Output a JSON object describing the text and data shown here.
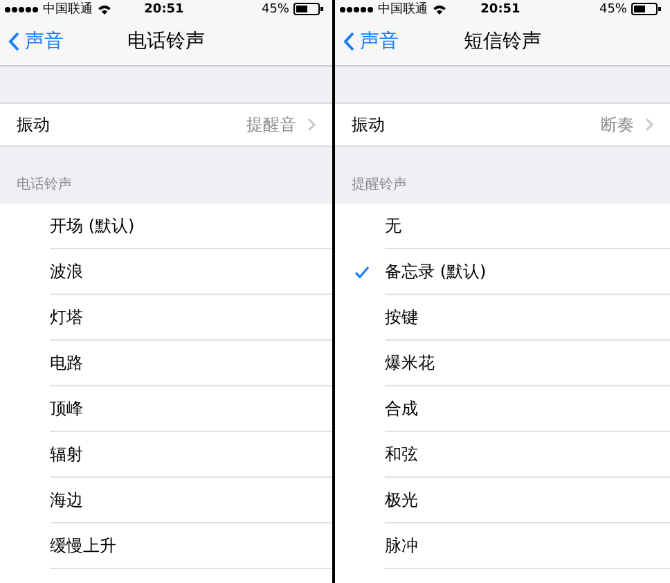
{
  "panels": [
    {
      "status_bar": {
        "carrier": "中国联通",
        "time": "20:51",
        "battery": "45%"
      },
      "nav_bar": {
        "back": "声音",
        "title": "电话铃声"
      },
      "vibration": {
        "label": "振动",
        "value": "提醒音"
      },
      "section_header": "电话铃声",
      "tones": [
        {
          "label": "开场 (默认)",
          "selected": false
        },
        {
          "label": "波浪",
          "selected": false
        },
        {
          "label": "灯塔",
          "selected": false
        },
        {
          "label": "电路",
          "selected": false
        },
        {
          "label": "顶峰",
          "selected": false
        },
        {
          "label": "辐射",
          "selected": false
        },
        {
          "label": "海边",
          "selected": false
        },
        {
          "label": "缓慢上升",
          "selected": false
        }
      ]
    },
    {
      "status_bar": {
        "carrier": "中国联通",
        "time": "20:51",
        "battery": "45%"
      },
      "nav_bar": {
        "back": "声音",
        "title": "短信铃声"
      },
      "vibration": {
        "label": "振动",
        "value": "断奏"
      },
      "section_header": "提醒铃声",
      "tones": [
        {
          "label": "无",
          "selected": false
        },
        {
          "label": "备忘录 (默认)",
          "selected": true
        },
        {
          "label": "按键",
          "selected": false
        },
        {
          "label": "爆米花",
          "selected": false
        },
        {
          "label": "合成",
          "selected": false
        },
        {
          "label": "和弦",
          "selected": false
        },
        {
          "label": "极光",
          "selected": false
        },
        {
          "label": "脉冲",
          "selected": false
        }
      ]
    }
  ]
}
